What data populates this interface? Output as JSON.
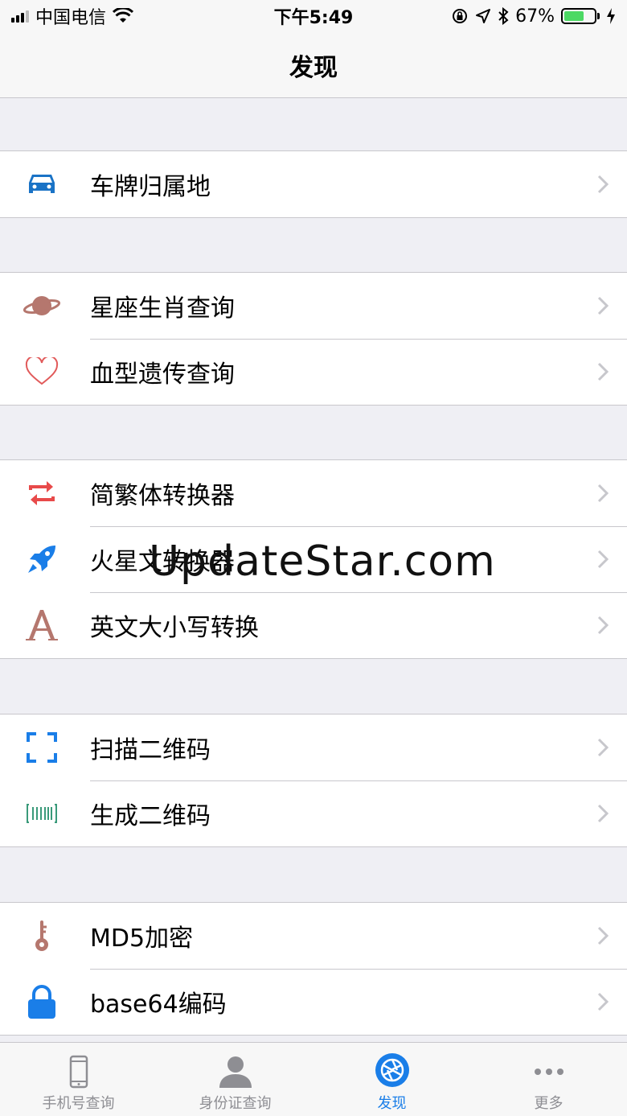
{
  "status": {
    "carrier": "中国电信",
    "time": "下午5:49",
    "battery": "67%",
    "battery_level": 0.67
  },
  "nav": {
    "title": "发现"
  },
  "groups": [
    {
      "items": [
        {
          "label": "车牌归属地",
          "icon": "car-icon"
        }
      ]
    },
    {
      "items": [
        {
          "label": "星座生肖查询",
          "icon": "planet-icon"
        },
        {
          "label": "血型遗传查询",
          "icon": "heart-icon"
        }
      ]
    },
    {
      "items": [
        {
          "label": "简繁体转换器",
          "icon": "swap-arrows-icon"
        },
        {
          "label": "火星文转换器",
          "icon": "rocket-icon"
        },
        {
          "label": "英文大小写转换",
          "icon": "letter-a-icon"
        }
      ]
    },
    {
      "items": [
        {
          "label": "扫描二维码",
          "icon": "scan-frame-icon"
        },
        {
          "label": "生成二维码",
          "icon": "barcode-icon"
        }
      ]
    },
    {
      "items": [
        {
          "label": "MD5加密",
          "icon": "key-icon"
        },
        {
          "label": "base64编码",
          "icon": "lock-icon"
        }
      ]
    }
  ],
  "tabs": [
    {
      "label": "手机号查询",
      "icon": "phone-icon",
      "active": false
    },
    {
      "label": "身份证查询",
      "icon": "person-icon",
      "active": false
    },
    {
      "label": "发现",
      "icon": "aperture-icon",
      "active": true
    },
    {
      "label": "更多",
      "icon": "more-icon",
      "active": false
    }
  ],
  "watermark": "UpdateStar.com",
  "colors": {
    "accent": "#1a7ee8",
    "car": "#1a73c6",
    "planet": "#b5776e",
    "heart": "#e15a5a",
    "swap": "#e84a4a",
    "rocket": "#1a7ee8",
    "letter": "#b5776e",
    "scan": "#1a7ee8",
    "barcode": "#3a9a7a",
    "key": "#b5776e",
    "lock": "#1a7ee8"
  }
}
